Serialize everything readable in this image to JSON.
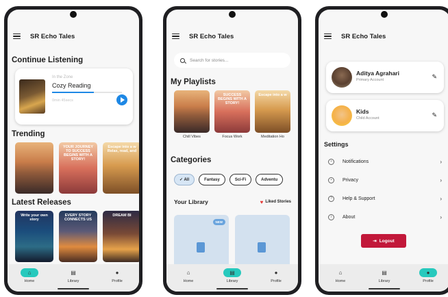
{
  "app": {
    "title": "SR Echo Tales"
  },
  "nav": {
    "home": "Home",
    "library": "Library",
    "profile": "Profile"
  },
  "phone1": {
    "continue_title": "Continue Listening",
    "continue_card": {
      "subtitle": "In the Zone",
      "title": "Cozy Reading",
      "meta": "0min 45secs",
      "progress": 0.6
    },
    "trending_title": "Trending",
    "trending_covers": [
      {
        "text": ""
      },
      {
        "text": "YOUR JOURNEY TO SUCCESS BEGINS WITH A STORY!"
      },
      {
        "text": "Escape into a w Relax, read, and"
      }
    ],
    "latest_title": "Latest Releases",
    "latest_covers": [
      {
        "text": "Write your own story"
      },
      {
        "text": "EVERY STORY CONNECTS US"
      },
      {
        "text": "DREAM BI"
      }
    ]
  },
  "phone2": {
    "search_placeholder": "Search for stories...",
    "playlists_title": "My Playlists",
    "playlists": [
      {
        "name": "Chill Vibes",
        "cover_text": ""
      },
      {
        "name": "Focus Work",
        "cover_text": "SUCCESS BEGINS WITH A STORY!"
      },
      {
        "name": "Meditation Ho",
        "cover_text": "Escape into a w"
      }
    ],
    "categories_title": "Categories",
    "categories": [
      "✓ All",
      "Fantasy",
      "Sci-Fi",
      "Adventu"
    ],
    "library_title": "Your Library",
    "liked_label": "Liked Stories",
    "new_badge": "NEW"
  },
  "phone3": {
    "accounts": [
      {
        "name": "Aditya Agrahari",
        "type": "Primary Account"
      },
      {
        "name": "Kids",
        "type": "Child Account"
      }
    ],
    "settings_title": "Settings",
    "settings_items": [
      "Notifications",
      "Privacy",
      "Help & Support",
      "About"
    ],
    "logout_label": "Logout"
  }
}
